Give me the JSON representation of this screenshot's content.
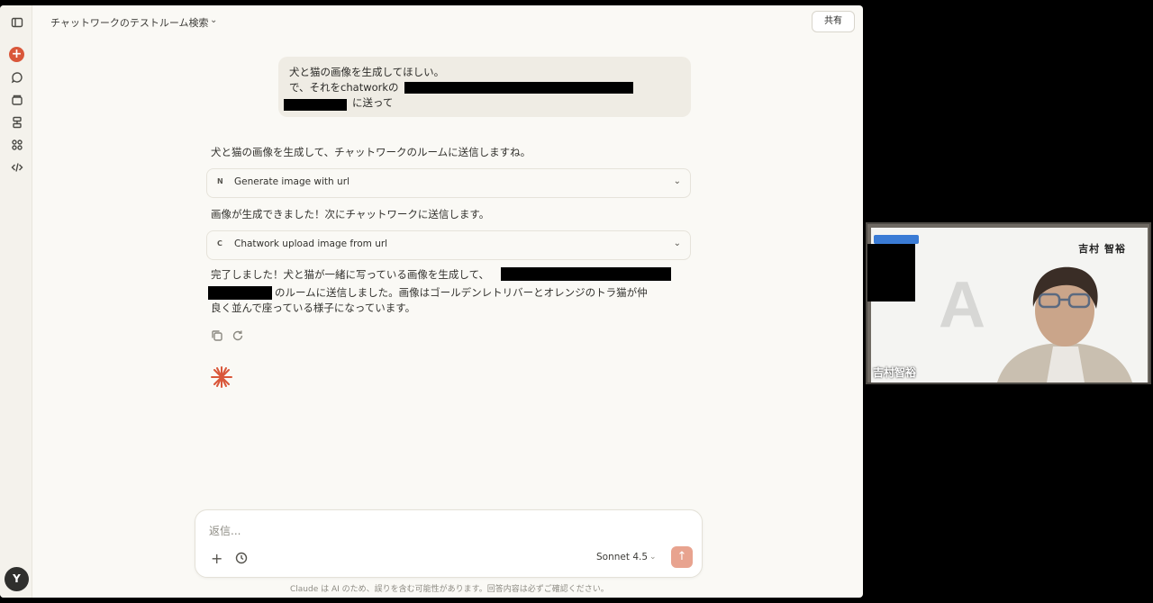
{
  "header": {
    "title": "チャットワークのテストルーム検索",
    "share_label": "共有"
  },
  "rail": {
    "icons": [
      "sidebar-toggle-icon",
      "new-chat-icon",
      "chats-icon",
      "projects-icon",
      "artifacts-icon",
      "apps-icon",
      "code-icon"
    ],
    "avatar_initial": "Y"
  },
  "user_message": {
    "line1": "犬と猫の画像を生成してほしい。",
    "line2": "で、それをchatworkの",
    "line3": "に送って"
  },
  "assistant": {
    "intro": "犬と猫の画像を生成して、チャットワークのルームに送信しますね。",
    "tool1": {
      "letter": "N",
      "label": "Generate image with url"
    },
    "middle": "画像が生成できました！次にチャットワークに送信します。",
    "tool2": {
      "letter": "C",
      "label": "Chatwork upload image from url"
    },
    "final_line1": "完了しました！犬と猫が一緒に写っている画像を生成して、",
    "final_line2": "のルームに送信しました。画像はゴールデンレトリバーとオレンジのトラ猫が仲",
    "final_line3": "良く並んで座っている様子になっています。"
  },
  "composer": {
    "placeholder": "返信...",
    "model": "Sonnet 4.5"
  },
  "disclaimer": "Claude は AI のため、誤りを含む可能性があります。回答内容は必ずご確認ください。",
  "video": {
    "presenter_name": "吉村智裕",
    "slide_name": "吉村 智裕"
  },
  "colors": {
    "accent": "#d9573a",
    "background": "#faf9f5",
    "send_button": "#e8a38f"
  }
}
